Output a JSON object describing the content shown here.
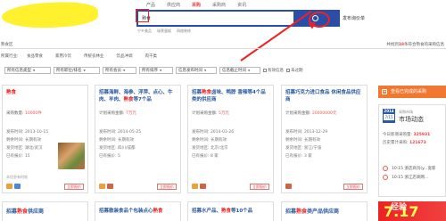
{
  "top_tabs": [
    "产品",
    "供应商",
    "采购",
    "采购商",
    "资讯"
  ],
  "active_tab": "采购",
  "search": {
    "value": "熟食",
    "placeholder": ""
  },
  "post_link": "发布询价单",
  "sublinks": [
    "宁乡美品",
    "瑞莱蛋糕",
    "网络装修"
  ],
  "location": {
    "label": "熟食区",
    "right_prefix": "共找到",
    "count": "18",
    "right_suffix": "条符合熟食的采购信息"
  },
  "category": {
    "label": "所属行业:",
    "items": [
      "食品零食",
      "家用冷饮",
      "传统农林业",
      "饮品冲调",
      "肉干类"
    ],
    "hint": ""
  },
  "filters": {
    "dropdowns": [
      "所有信息类型",
      "所有职位/排名",
      "所有会员",
      "所有排序",
      "信息发布时间",
      "信息截止时间"
    ],
    "checkboxes": [
      "有效信息",
      "未过期"
    ]
  },
  "cards": [
    {
      "title_pre": "",
      "title_hl": "熟食",
      "title_post": "",
      "budget_label": "采购数量:",
      "budget_value": "10000件",
      "info": [
        "发布时间: 2013-10-15",
        "剩余时间: 长期有效",
        "发货地区: 湖北/武汉",
        "已有报价: 15"
      ],
      "foot": "本信息有时效",
      "apply": "立即报价"
    },
    {
      "title_pre": "招募海鲜、海参、浮萍、点心、牛肉、羊肉、",
      "title_hl": "熟食",
      "title_post": "等7个品",
      "budget_label": "计划采购金额:",
      "budget_value": "7万元",
      "info": [
        "发布时间: 2014-05-25",
        "剩余时间: 长期有效",
        "发货地区: 四川/成都",
        "已有报价: 5"
      ],
      "foot": "",
      "apply": "立即报价"
    },
    {
      "title_pre": "招募",
      "title_hl": "熟食",
      "title_post": "卤味、鸭脖 香辣等4个品类的供应商",
      "budget_label": "计划采购金额:",
      "budget_value": "5万元",
      "info": [
        "发布时间: 2014-03-26",
        "剩余时间: 长期有效",
        "发货地区: 北京/北京",
        "已有报价: 8 家"
      ],
      "foot": "",
      "apply": "立即报价"
    },
    {
      "title_pre": "招募巧克力进口食品 休闲食品供应商",
      "title_hl": "",
      "title_post": "",
      "budget_label": "计划采购金额:",
      "budget_value": "20000000元",
      "info": [
        "发布时间: 2013-12-29",
        "剩余时间: 长期有效",
        "发货地区: 浙江/宁波",
        "已有报价: 3 家"
      ],
      "foot": "",
      "apply": "立即报价"
    }
  ],
  "row2": [
    {
      "title_pre": "招募",
      "title_hl": "熟食",
      "title_post": "供应商"
    },
    {
      "title_pre": "招募散装食品个包装点心",
      "title_hl": "熟食",
      "title_post": ""
    },
    {
      "title_pre": "招募水产品、",
      "title_hl": "熟食",
      "title_post": "等10个品"
    },
    {
      "title_pre": "招募",
      "title_hl": "熟食",
      "title_post": "类产品供应商"
    }
  ],
  "side": {
    "button": "查看已完成的采购",
    "year": "2014",
    "date": "7/15",
    "market_sub": "采购市场",
    "market_title": "市场动态",
    "stats": [
      {
        "label": "今日新增采购量:",
        "value": "325931"
      },
      {
        "label": "历史累计采购:",
        "value": "121673"
      }
    ],
    "news": [
      "10:15 浙店商沟(y...宽新",
      "10:15 浙江店商网..."
    ],
    "promo": "7.17",
    "watermark": "经验"
  },
  "colors": {
    "brand_blue": "#2a4ea8",
    "accent_red": "#e22222",
    "orange": "#f07830"
  }
}
